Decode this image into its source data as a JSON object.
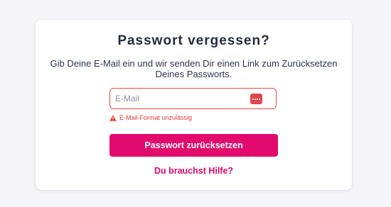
{
  "form": {
    "title": "Passwort vergessen?",
    "subtitle": "Gib Deine E-Mail ein und wir senden Dir einen Link zum Zurücksetzen Deines Passworts.",
    "email": {
      "value": "",
      "placeholder": "E-Mail",
      "trailing_icon": "password-dots-icon"
    },
    "error": {
      "icon": "warning-triangle-icon",
      "message": "E-Mail-Format unzulässig"
    },
    "submit_label": "Passwort zurücksetzen",
    "help_link": "Du brauchst Hilfe?"
  },
  "colors": {
    "background": "#f4f4f9",
    "card": "#ffffff",
    "primary": "#e20a6c",
    "error": "#e23a3a",
    "title_text": "#262b3d"
  }
}
